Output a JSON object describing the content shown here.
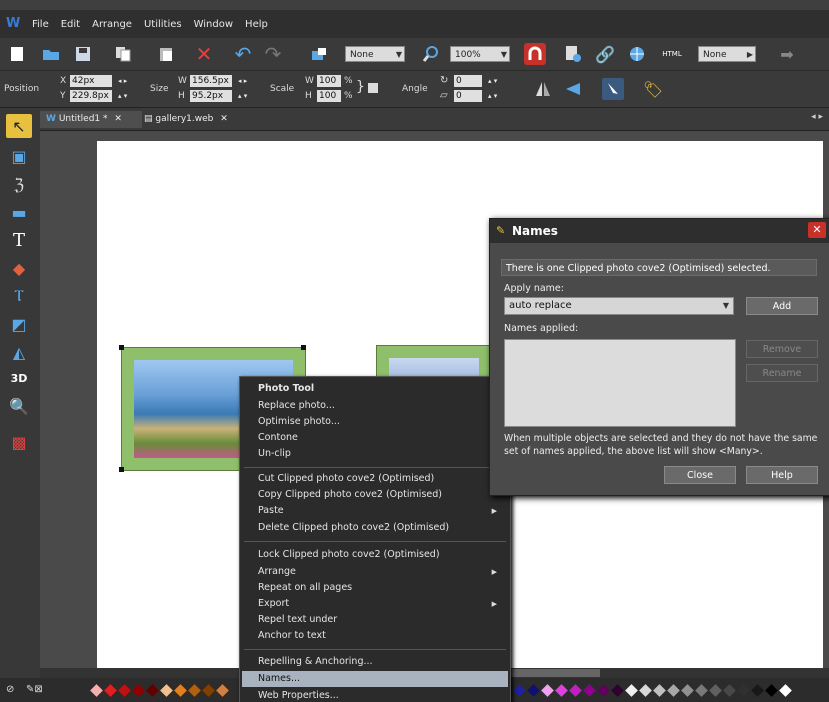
{
  "menubar": {
    "app_icon": "W",
    "items": [
      "File",
      "Edit",
      "Arrange",
      "Utilities",
      "Window",
      "Help"
    ]
  },
  "toolbar": {
    "none_select_1": "None",
    "zoom_select": "100%",
    "none_select_2": "None",
    "html_label": "HTML"
  },
  "infobar": {
    "position_label": "Position",
    "x_label": "X",
    "x_value": "42px",
    "y_label": "Y",
    "y_value": "229.8px",
    "size_label": "Size",
    "w_label": "W",
    "w_value": "156.5px",
    "h_label": "H",
    "h_value": "95.2px",
    "scale_label": "Scale",
    "scale_w_value": "100",
    "scale_h_value": "100",
    "percent": "%",
    "angle_label": "Angle",
    "angle_value": "0",
    "shear_value": "0"
  },
  "tabs": [
    {
      "label": "Untitled1 *",
      "close": "✕"
    },
    {
      "label": "gallery1.web",
      "close": "✕"
    }
  ],
  "tabs_nav": "◂ ▸",
  "context_menu": {
    "header": "Photo Tool",
    "items_group1": [
      "Replace photo...",
      "Optimise photo...",
      "Contone",
      "Un-clip"
    ],
    "items_group2": [
      "Cut Clipped photo cove2 (Optimised)",
      "Copy Clipped photo cove2 (Optimised)",
      "Paste",
      "Delete Clipped photo cove2 (Optimised)"
    ],
    "items_group3": [
      "Lock Clipped photo cove2 (Optimised)",
      "Arrange",
      "Repeat on all pages",
      "Export",
      "Repel text under",
      "Anchor to text"
    ],
    "items_group4": [
      "Repelling & Anchoring...",
      "Names...",
      "Web Properties..."
    ]
  },
  "dialog": {
    "title": "Names",
    "close": "✕",
    "info": "There is one Clipped photo cove2 (Optimised) selected.",
    "apply_label": "Apply name:",
    "apply_value": "auto replace",
    "add_button": "Add",
    "applied_label": "Names applied:",
    "remove_button": "Remove",
    "rename_button": "Rename",
    "note": "When multiple objects are selected and they do not have the same set of names applied, the above list will show <Many>.",
    "close_button": "Close",
    "help_button": "Help"
  },
  "colors": {
    "accent_red": "#c8302a",
    "menu_highlight": "#a9b3bf",
    "frame_green": "#8fbf6a"
  }
}
